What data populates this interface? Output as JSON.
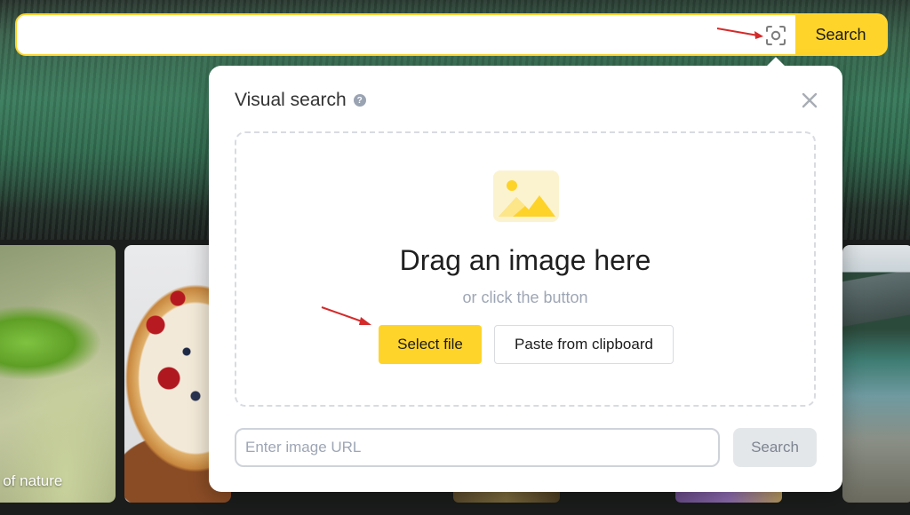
{
  "header": {
    "search_value": "",
    "search_button_label": "Search",
    "camera_icon": "visual-search-camera-icon"
  },
  "background": {
    "leaf_caption": "y of nature"
  },
  "visual_search": {
    "title": "Visual search",
    "help_icon_text": "?",
    "drag_title": "Drag an image here",
    "drag_subtitle": "or click the button",
    "select_file_label": "Select file",
    "paste_label": "Paste from clipboard",
    "url_placeholder": "Enter image URL",
    "url_search_label": "Search"
  },
  "colors": {
    "accent": "#fed42b",
    "annotation_arrow": "#d42a2a"
  }
}
